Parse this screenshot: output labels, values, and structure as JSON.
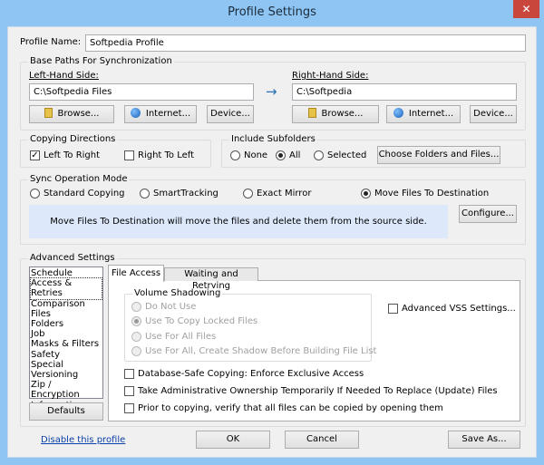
{
  "window": {
    "title": "Profile Settings",
    "close": "✕"
  },
  "profile": {
    "label": "Profile Name:",
    "value": "Softpedia Profile"
  },
  "base_paths": {
    "title": "Base Paths For Synchronization",
    "left": {
      "label": "Left-Hand Side:",
      "value": "C:\\Softpedia Files"
    },
    "right": {
      "label": "Right-Hand Side:",
      "value": "C:\\Softpedia"
    },
    "arrow": "→",
    "browse": "Browse...",
    "internet": "Internet...",
    "device": "Device..."
  },
  "copying": {
    "title": "Copying Directions",
    "ltr": "Left To Right",
    "rtl": "Right To Left",
    "ltr_checked": true,
    "rtl_checked": false
  },
  "subfolders": {
    "title": "Include Subfolders",
    "none": "None",
    "all": "All",
    "selected": "Selected",
    "selected_value": "All",
    "choose": "Choose Folders and Files..."
  },
  "sync_mode": {
    "title": "Sync Operation Mode",
    "options": [
      "Standard Copying",
      "SmartTracking",
      "Exact Mirror",
      "Move Files To Destination"
    ],
    "selected": "Move Files To Destination",
    "info": "Move Files To Destination will move the files and delete them from the source side.",
    "configure": "Configure..."
  },
  "advanced": {
    "title": "Advanced Settings",
    "list": [
      "Schedule",
      "Access & Retries",
      "Comparison",
      "Files",
      "Folders",
      "Job",
      "Masks & Filters",
      "Safety",
      "Special",
      "Versioning",
      "Zip / Encryption",
      "Information"
    ],
    "list_selected": "Access & Retries",
    "defaults": "Defaults",
    "tabs": [
      "File Access",
      "Waiting and Retrying"
    ],
    "active_tab": "File Access",
    "volume": {
      "title": "Volume Shadowing",
      "options": [
        "Do Not Use",
        "Use To Copy Locked Files",
        "Use For All Files",
        "Use For All, Create Shadow Before Building File List"
      ],
      "selected": "Use To Copy Locked Files"
    },
    "vss": "Advanced VSS Settings...",
    "checks": [
      "Database-Safe Copying: Enforce Exclusive Access",
      "Take Administrative Ownership Temporarily If Needed To Replace (Update) Files",
      "Prior to copying, verify that all files can be copied by opening them"
    ]
  },
  "footer": {
    "disable": "Disable this profile",
    "ok": "OK",
    "cancel": "Cancel",
    "save_as": "Save As..."
  },
  "colors": {
    "titlebar": "#8ec5f2",
    "close": "#c9463d",
    "info_bg": "#dde9fb",
    "link": "#0b3fa8"
  }
}
